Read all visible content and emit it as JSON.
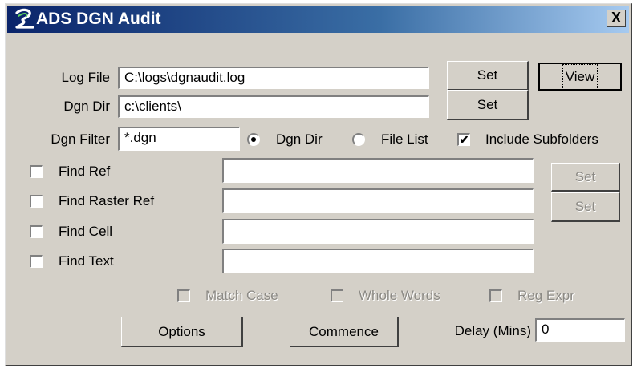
{
  "window": {
    "title": "ADS DGN Audit",
    "close_label": "X"
  },
  "log_file": {
    "label": "Log File",
    "value": "C:\\logs\\dgnaudit.log",
    "set_label": "Set",
    "view_label": "View"
  },
  "dgn_dir": {
    "label": "Dgn Dir",
    "value": "c:\\clients\\",
    "set_label": "Set"
  },
  "dgn_filter": {
    "label": "Dgn Filter",
    "value": "*.dgn",
    "radio_dgn_dir": {
      "label": "Dgn Dir",
      "selected": true
    },
    "radio_file_list": {
      "label": "File List",
      "selected": false
    },
    "include_subfolders": {
      "label": "Include Subfolders",
      "checked": true,
      "checkmark": "✔"
    }
  },
  "find": [
    {
      "label": "Find Ref",
      "checked": false,
      "value": ""
    },
    {
      "label": "Find Raster Ref",
      "checked": false,
      "value": ""
    },
    {
      "label": "Find Cell",
      "checked": false,
      "value": ""
    },
    {
      "label": "Find Text",
      "checked": false,
      "value": ""
    }
  ],
  "find_set_buttons": [
    "Set",
    "Set"
  ],
  "search_options": {
    "match_case": {
      "label": "Match Case",
      "checked": false,
      "enabled": false
    },
    "whole_words": {
      "label": "Whole Words",
      "checked": false,
      "enabled": false
    },
    "reg_expr": {
      "label": "Reg Expr",
      "checked": false,
      "enabled": false
    }
  },
  "footer": {
    "options_label": "Options",
    "commence_label": "Commence",
    "delay_label": "Delay (Mins)",
    "delay_value": "0"
  },
  "colors": {
    "face": "#d4d0c8",
    "title_start": "#0a246a",
    "title_end": "#a6caf0",
    "disabled_text": "#8c8a85"
  },
  "icons": {
    "app": "ads-logo-icon",
    "close": "close-icon",
    "check": "checkmark-icon",
    "radio": "radio-dot-icon"
  }
}
